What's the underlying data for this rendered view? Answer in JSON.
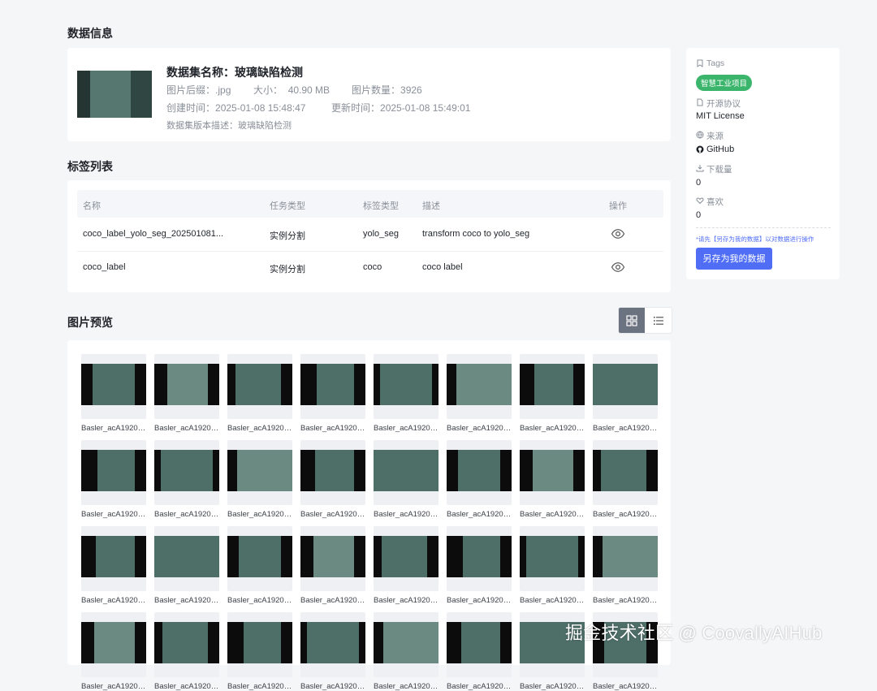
{
  "sections": {
    "data_info": "数据信息",
    "label_list": "标签列表",
    "image_preview": "图片预览"
  },
  "dataset": {
    "name_label": "数据集名称：",
    "name": "玻璃缺陷检测",
    "suffix_label": "图片后缀：",
    "suffix": ".jpg",
    "size_label": "大小：",
    "size": "40.90 MB",
    "count_label": "图片数量：",
    "count": "3926",
    "created_label": "创建时间：",
    "created": "2025-01-08 15:48:47",
    "updated_label": "更新时间：",
    "updated": "2025-01-08 15:49:01",
    "desc_label": "数据集版本描述：",
    "desc": "玻璃缺陷检测"
  },
  "label_table": {
    "headers": [
      "名称",
      "任务类型",
      "标签类型",
      "描述",
      "操作"
    ],
    "rows": [
      {
        "name": "coco_label_yolo_seg_202501081...",
        "task": "实例分割",
        "type": "yolo_seg",
        "desc": "transform coco to yolo_seg"
      },
      {
        "name": "coco_label",
        "task": "实例分割",
        "type": "coco",
        "desc": "coco label"
      }
    ]
  },
  "view_toggle": {
    "active": "grid"
  },
  "images": {
    "item_name": "Basler_acA1920-...",
    "colors": {
      "glass": "#4e6e68",
      "glass_light": "#6a8a82",
      "frame": "#0c0c0c"
    }
  },
  "sidebar": {
    "tags_label": "Tags",
    "tag": "智慧工业项目",
    "license_label": "开源协议",
    "license": "MIT License",
    "source_label": "来源",
    "source": "GitHub",
    "downloads_label": "下载量",
    "downloads": "0",
    "likes_label": "喜欢",
    "likes": "0",
    "hint": "*请先【另存为我的数据】以对数据进行操作",
    "save_button": "另存为我的数据"
  },
  "watermark": "掘金技术社区 @ CoovallyAIHub"
}
